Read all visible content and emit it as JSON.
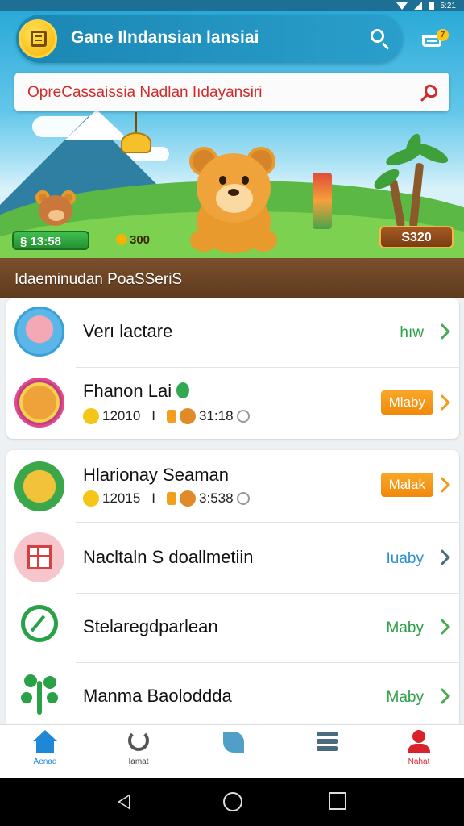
{
  "status_bar": {
    "time": "5:21"
  },
  "app_bar": {
    "title": "Gane Ilndansian lansiai",
    "cart_badge": "7"
  },
  "notice": {
    "text": "OpreCassaissia Nadlan Iıdayansiri"
  },
  "hero": {
    "chip_left": "§ 13:58",
    "chip_mid": "300",
    "chip_right": "S320",
    "section_label": "Idaeminudan PoaSSeriS"
  },
  "list_primary": [
    {
      "title": "Verı lactare",
      "action": "hıw",
      "action_style": "link-green",
      "avatar": "pig-avatar"
    },
    {
      "title": "Fhanon Lai",
      "meta_count": "12010",
      "meta_sep": "I",
      "meta_time": "31:18",
      "action": "Mlaby",
      "action_style": "button-orange",
      "avatar": "bear-avatar"
    }
  ],
  "list_secondary": [
    {
      "title": "Hlarionay Seaman",
      "meta_count": "12015",
      "meta_sep": "I",
      "meta_time": "3:538",
      "action": "Malak",
      "action_style": "button-orange",
      "avatar": "duck-avatar"
    },
    {
      "title": "Nacltaln S doallmetiin",
      "action": "Iuaby",
      "action_style": "link-blue",
      "avatar": "grid-icon"
    },
    {
      "title": "Stelaregdparlean",
      "action": "Maby",
      "action_style": "link-green",
      "avatar": "leaf-circle-icon"
    },
    {
      "title": "Manma Baoloddda",
      "action": "Maby",
      "action_style": "link-green",
      "avatar": "tree-icon"
    }
  ],
  "bottom_nav": [
    {
      "label": "Aenad",
      "icon": "home-icon",
      "active": true
    },
    {
      "label": "Iamat",
      "icon": "refresh-icon",
      "active": false
    },
    {
      "label": "",
      "icon": "leaf-icon",
      "active": false
    },
    {
      "label": "",
      "icon": "stack-icon",
      "active": false
    },
    {
      "label": "Nahat",
      "icon": "profile-icon",
      "active": false
    }
  ],
  "colors": {
    "accent": "#1b86b3",
    "green": "#2aa146",
    "orange": "#f39b1a",
    "alert_red": "#d02b2b"
  }
}
